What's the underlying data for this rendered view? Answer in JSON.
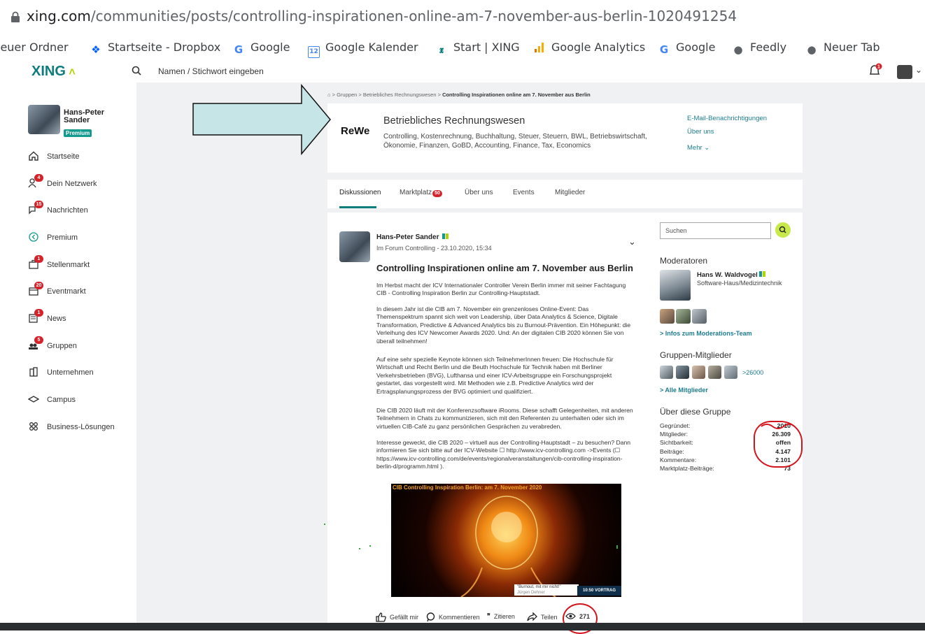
{
  "browser": {
    "url_domain": "xing.com",
    "url_path": "/communities/posts/controlling-inspirationen-online-am-7-november-aus-berlin-1020491254",
    "bookmarks": [
      {
        "label": "leuer Ordner",
        "icon": "folder-icon"
      },
      {
        "label": "Startseite - Dropbox",
        "icon": "dropbox-icon"
      },
      {
        "label": "Google",
        "icon": "google-icon"
      },
      {
        "label": "Google Kalender",
        "icon": "calendar-icon"
      },
      {
        "label": "Start | XING",
        "icon": "xing-icon"
      },
      {
        "label": "Google Analytics",
        "icon": "analytics-icon"
      },
      {
        "label": "Google",
        "icon": "google-icon"
      },
      {
        "label": "Feedly",
        "icon": "globe-icon"
      },
      {
        "label": "Neuer Tab",
        "icon": "globe-icon"
      }
    ]
  },
  "header": {
    "logo": "XING",
    "search_placeholder": "Namen / Stichwort eingeben",
    "bell_badge": "1"
  },
  "sidebar": {
    "user_name": "Hans-Peter Sander",
    "badge": "Premium",
    "items": [
      {
        "label": "Startseite",
        "icon": "home-icon",
        "badge": ""
      },
      {
        "label": "Dein Netzwerk",
        "icon": "network-icon",
        "badge": "4"
      },
      {
        "label": "Nachrichten",
        "icon": "messages-icon",
        "badge": "15"
      },
      {
        "label": "Premium",
        "icon": "premium-icon",
        "badge": ""
      },
      {
        "label": "Stellenmarkt",
        "icon": "jobs-icon",
        "badge": "1"
      },
      {
        "label": "Eventmarkt",
        "icon": "events-icon",
        "badge": "20"
      },
      {
        "label": "News",
        "icon": "news-icon",
        "badge": "1"
      },
      {
        "label": "Gruppen",
        "icon": "groups-icon",
        "badge": "5"
      },
      {
        "label": "Unternehmen",
        "icon": "company-icon",
        "badge": ""
      },
      {
        "label": "Campus",
        "icon": "campus-icon",
        "badge": ""
      },
      {
        "label": "Business-Lösungen",
        "icon": "business-icon",
        "badge": ""
      }
    ]
  },
  "breadcrumb": {
    "items": [
      "Gruppen",
      "Betriebliches Rechnungswesen"
    ],
    "current": "Controlling Inspirationen online am 7. November aus Berlin"
  },
  "group": {
    "logo_text": "ReWe",
    "title": "Betriebliches Rechnungswesen",
    "tags": "Controlling, Kostenrechnung, Buchhaltung, Steuer, Steuern, BWL, Betriebswirtschaft, Ökonomie, Finanzen, GoBD, Accounting, Finance, Tax, Economics",
    "links": [
      "E-Mail-Benachrichtigungen",
      "Über uns",
      "Mehr"
    ]
  },
  "tabs": [
    {
      "label": "Diskussionen",
      "badge": ""
    },
    {
      "label": "Marktplatz",
      "badge": "50"
    },
    {
      "label": "Über uns",
      "badge": ""
    },
    {
      "label": "Events",
      "badge": ""
    },
    {
      "label": "Mitglieder",
      "badge": ""
    }
  ],
  "post": {
    "author": "Hans-Peter Sander",
    "meta": "Im Forum Controlling - 23.10.2020, 15:34",
    "title": "Controlling Inspirationen online am 7. November aus Berlin",
    "paragraphs": [
      "Im Herbst macht der ICV Internationaler Controller Verein Berlin immer mit seiner Fachtagung CIB - Controlling Inspiration Berlin zur Controlling-Hauptstadt.",
      "In diesem Jahr ist die CIB am 7. November ein grenzenloses Online-Event: Das Themenspektrum spannt sich weit von Leadership, über Data Analytics & Science, Digitale Transformation, Predictive & Advanced Analytics bis zu Burnout-Prävention. Ein Höhepunkt: die Verleihung des ICV Newcomer Awards 2020. Und: An der digitalen CIB 2020 können Sie von überall teilnehmen!",
      "Auf eine sehr spezielle Keynote können sich TeilnehmerInnen freuen: Die Hochschule für Wirtschaft und Recht Berlin und die Beuth Hochschule für Technik haben mit Berliner Verkehrsbetrieben (BVG), Lufthansa und einer ICV-Arbeitsgruppe ein Forschungsprojekt gestartet, das vorgestellt wird. Mit Methoden wie z.B. Predictive Analytics wird der Ertragsplanungsprozess der BVG optimiert und qualifiziert.",
      "Die CIB 2020 läuft mit der Konferenzsoftware iRooms. Diese schafft Gelegenheiten, mit anderen Teilnehmern in Chats zu kommunizieren, sich mit den Referenten zu unterhalten oder sich im virtuellen CIB-Café zu ganz persönlichen Gesprächen zu verabreden.",
      "Interesse geweckt, die CIB 2020 – virtuell aus der Controlling-Hauptstadt – zu besuchen? Dann informieren Sie sich bitte auf der ICV-Website ☐ http://www.icv-controlling.com  ->Events (☐ https://www.icv-controlling.com/de/events/regionalveranstaltungen/cib-controlling-inspiration-berlin-d/programm.html  )."
    ],
    "image_caption": "CIB Controlling Inspiration Berlin: am 7. November 2020",
    "image_quote": "\"Burnout, mit mir nicht!\"",
    "image_quote_by": "Jürgen Dehner",
    "image_tag": "10:50 VORTRAG",
    "actions": {
      "like": "Gefällt mir",
      "comment": "Kommentieren",
      "quote": "Zitieren",
      "share": "Teilen",
      "views": "271"
    }
  },
  "right": {
    "search_placeholder": "Suchen",
    "moderators_title": "Moderatoren",
    "moderator_name": "Hans W. Waldvogel",
    "moderator_sub": "Software-Haus/Medizintechnik",
    "moderators_link": "> Infos zum Moderations-Team",
    "members_title": "Gruppen-Mitglieder",
    "members_count": ">26000",
    "members_link": "> Alle Mitglieder",
    "about_title": "Über diese Gruppe",
    "stats": [
      {
        "label": "Gegründet:",
        "value": "2010"
      },
      {
        "label": "Mitglieder:",
        "value": "26.309"
      },
      {
        "label": "Sichtbarkeit:",
        "value": "offen"
      },
      {
        "label": "Beiträge:",
        "value": "4.147"
      },
      {
        "label": "Kommentare:",
        "value": "2.101"
      },
      {
        "label": "Marktplatz-Beiträge:",
        "value": "73"
      }
    ]
  },
  "colors": {
    "xing_green": "#0c7c7c",
    "badge_red": "#d4232b",
    "annotation_red": "#d3141c",
    "arrow_fill": "#c6e5e6"
  }
}
